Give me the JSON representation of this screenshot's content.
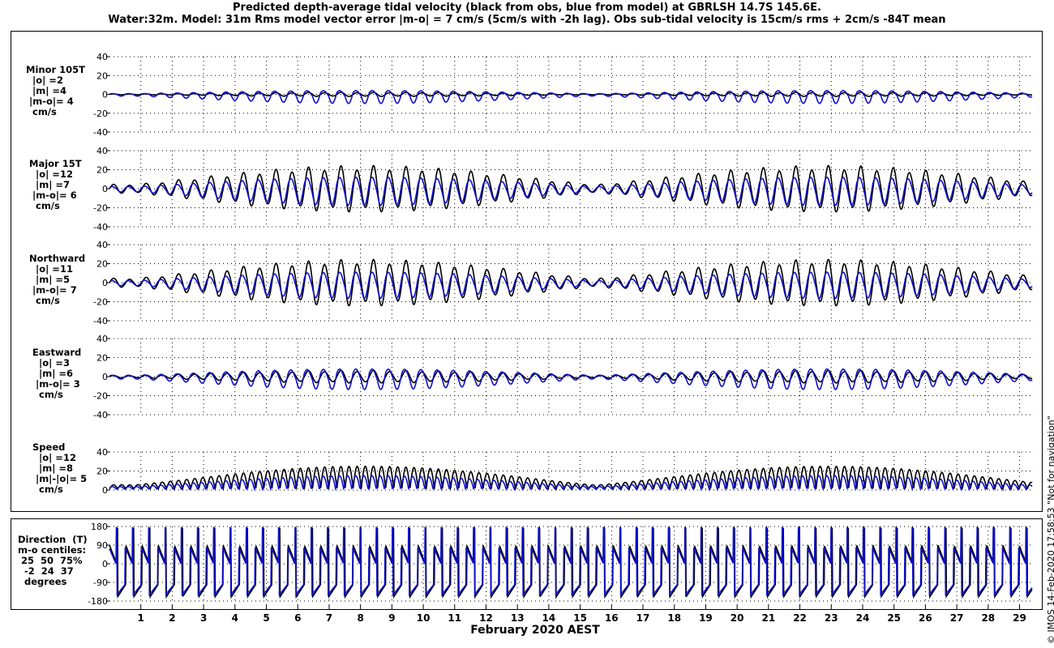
{
  "title_line1": "Predicted depth-average tidal velocity (black from obs, blue from model) at GBRLSH 14.7S 145.6E.",
  "title_line2": "Water:32m. Model: 31m  Rms model vector error |m-o| = 7 cm/s (5cm/s with -2h lag). Obs sub-tidal velocity is 15cm/s rms + 2cm/s -84T mean",
  "side_note": "© IMOS 14-Feb-2020 17:58:53  \"Not for navigation\"",
  "colors": {
    "obs": "#000000",
    "model": "#1010c8",
    "grid": "#000000"
  },
  "chart_data": {
    "type": "line",
    "xlabel": "February 2020 AEST",
    "x_ticks": [
      "1",
      "2",
      "3",
      "4",
      "5",
      "6",
      "7",
      "8",
      "9",
      "10",
      "11",
      "12",
      "13",
      "14",
      "15",
      "16",
      "17",
      "18",
      "19",
      "20",
      "21",
      "22",
      "23",
      "24",
      "25",
      "26",
      "27",
      "28",
      "29"
    ],
    "xlim": [
      0,
      29.4
    ],
    "series_names": [
      "obs (black)",
      "model (blue)"
    ],
    "panels": [
      {
        "id": "minor",
        "label_lines": [
          "Minor 105T",
          "  |o| =2",
          "  |m| =4",
          " |m-o|= 4",
          "  cm/s"
        ],
        "ylim": [
          -40,
          40
        ],
        "yticks": [
          "40",
          "20",
          "0",
          "-20",
          "-40"
        ],
        "obs_amplitude": 2,
        "model_amplitude": 4,
        "model_offset": -3
      },
      {
        "id": "major",
        "label_lines": [
          "Major 15T",
          "  |o| =12",
          "  |m| =7",
          " |m-o|= 6",
          "  cm/s"
        ],
        "ylim": [
          -40,
          40
        ],
        "yticks": [
          "40",
          "20",
          "0",
          "-20",
          "-40"
        ],
        "obs_amplitude": 22,
        "model_amplitude": 12,
        "model_offset": -3
      },
      {
        "id": "northward",
        "label_lines": [
          "Northward",
          "  |o| =11",
          "  |m| =5",
          " |m-o|= 7",
          "  cm/s"
        ],
        "ylim": [
          -40,
          40
        ],
        "yticks": [
          "40",
          "20",
          "0",
          "-20",
          "-40"
        ],
        "obs_amplitude": 22,
        "model_amplitude": 11,
        "model_offset": -3
      },
      {
        "id": "eastward",
        "label_lines": [
          "Eastward",
          "  |o| =3",
          "  |m| =6",
          " |m-o|= 3",
          "  cm/s"
        ],
        "ylim": [
          -40,
          40
        ],
        "yticks": [
          "40",
          "20",
          "0",
          "-20",
          "-40"
        ],
        "obs_amplitude": 6,
        "model_amplitude": 8,
        "model_offset": -3
      },
      {
        "id": "speed",
        "label_lines": [
          "Speed",
          "  |o| =12",
          "  |m| =8",
          " |m|-|o|= 5",
          "  cm/s"
        ],
        "ylim": [
          0,
          40
        ],
        "yticks": [
          "40",
          "20",
          "0"
        ],
        "obs_amplitude": 24,
        "model_amplitude": 14,
        "model_offset": 0
      },
      {
        "id": "direction",
        "label_lines": [
          "Direction  (T)",
          "m-o centiles:",
          " 25  50  75%",
          "  -2  24  37",
          "  degrees"
        ],
        "ylim": [
          -180,
          180
        ],
        "yticks": [
          "180",
          "90",
          "0",
          "-90",
          "-180"
        ]
      }
    ]
  }
}
